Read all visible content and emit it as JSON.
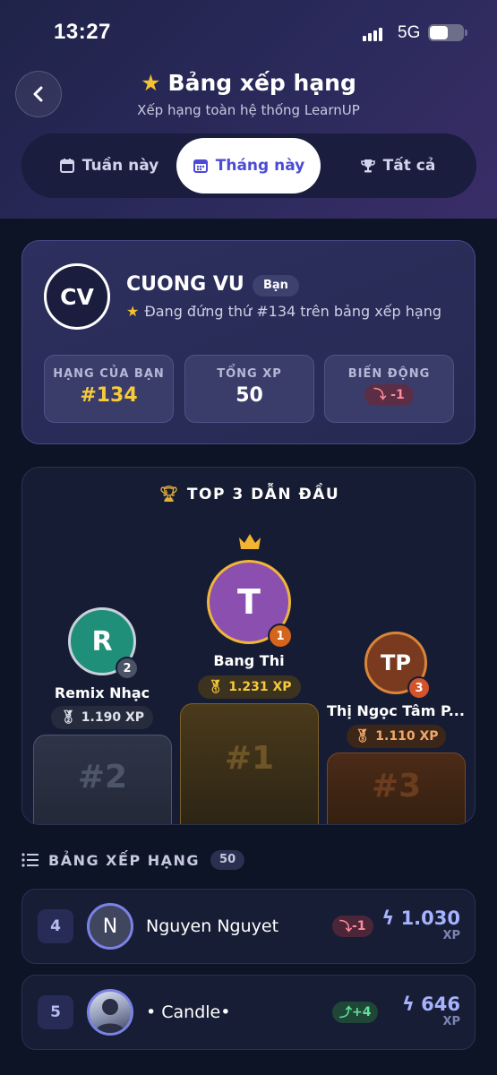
{
  "status_bar": {
    "time": "13:27",
    "network": "5G"
  },
  "header": {
    "title": "Bảng xếp hạng",
    "subtitle": "Xếp hạng toàn hệ thống LearnUP"
  },
  "tabs": [
    {
      "label": "Tuần này",
      "icon": "calendar-icon",
      "active": false
    },
    {
      "label": "Tháng này",
      "icon": "calendar-icon",
      "active": true
    },
    {
      "label": "Tất cả",
      "icon": "trophy-icon",
      "active": false
    }
  ],
  "profile": {
    "initials": "CV",
    "name": "CUONG VU",
    "you_badge": "Bạn",
    "rank_text": "Đang đứng thứ #134 trên bảng xếp hạng",
    "stats": {
      "rank_label": "HẠNG CỦA BẠN",
      "rank_value": "#134",
      "xp_label": "TỔNG XP",
      "xp_value": "50",
      "change_label": "BIẾN ĐỘNG",
      "change_value": "-1"
    }
  },
  "top3": {
    "title": "TOP 3 DẪN ĐẦU",
    "first": {
      "initial": "T",
      "name": "Bang Thi",
      "xp": "1.231 XP",
      "rank": "1",
      "podium": "#1",
      "color": "#8b4fb0"
    },
    "second": {
      "initial": "R",
      "name": "Remix Nhạc",
      "xp": "1.190 XP",
      "rank": "2",
      "podium": "#2",
      "color": "#1f8f7a"
    },
    "third": {
      "initial": "TP",
      "name": "Thị Ngọc Tâm P...",
      "xp": "1.110 XP",
      "rank": "3",
      "podium": "#3",
      "color": "#7a3a20"
    }
  },
  "leaderboard": {
    "title": "BẢNG XẾP HẠNG",
    "count": "50",
    "rows": [
      {
        "rank": "4",
        "initial": "N",
        "name": "Nguyen Nguyet",
        "change": "-1",
        "trend": "down",
        "xp": "1.030",
        "unit": "XP"
      },
      {
        "rank": "5",
        "initial": "",
        "name": "• Candle•",
        "change": "+4",
        "trend": "up",
        "xp": "646",
        "unit": "XP"
      }
    ]
  },
  "colors": {
    "accent": "#4b4bd6",
    "gold": "#f6ca3b",
    "background": "#0d1426"
  }
}
